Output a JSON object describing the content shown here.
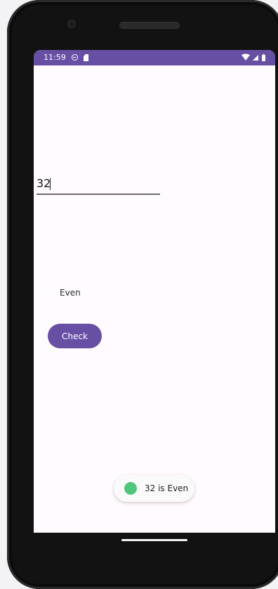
{
  "status_bar": {
    "time": "11:59",
    "icons": [
      "do-not-disturb-icon",
      "sd-card-icon",
      "wifi-icon",
      "signal-icon",
      "battery-icon"
    ]
  },
  "form": {
    "number_value": "32",
    "result_text": "Even",
    "check_label": "Check"
  },
  "toast": {
    "message": "32 is Even",
    "icon": "android-icon"
  },
  "colors": {
    "primary": "#6750a4",
    "screen_background": "#fffbfe",
    "toast_icon": "#4fc67c"
  }
}
